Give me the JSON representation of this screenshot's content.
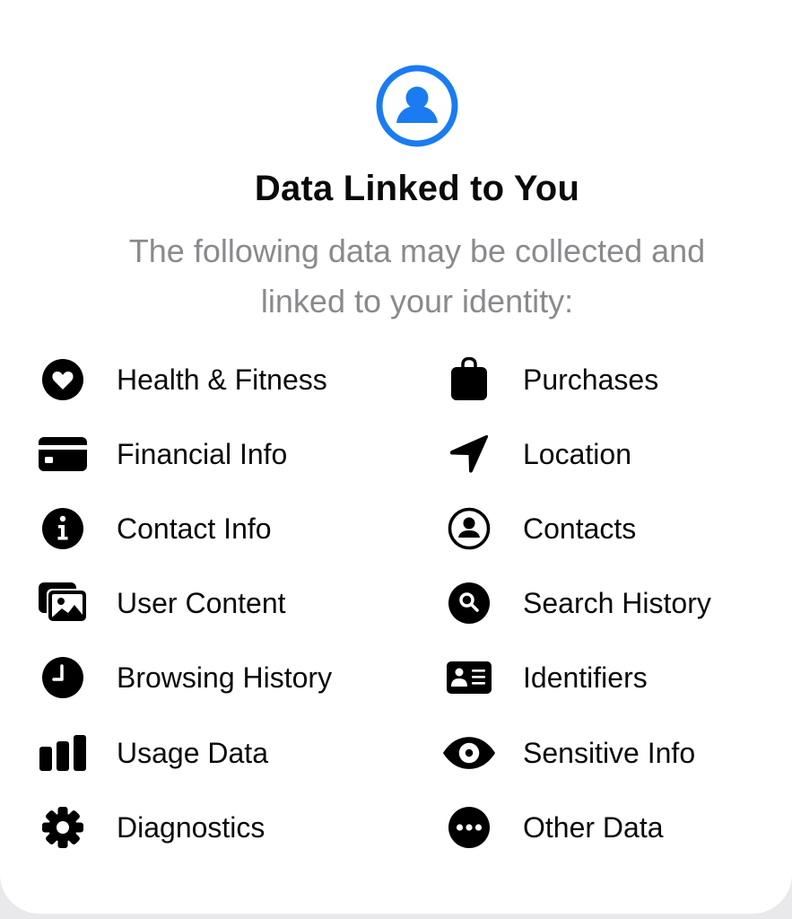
{
  "header": {
    "icon": "person-circle-icon",
    "icon_color": "#1a7cf0",
    "title": "Data Linked to You",
    "subtitle_line1": "The following data may be collected and",
    "subtitle_line2": "linked to your identity:"
  },
  "items_left": [
    {
      "label": "Health & Fitness",
      "icon": "heart-circle-icon"
    },
    {
      "label": "Financial Info",
      "icon": "credit-card-icon"
    },
    {
      "label": "Contact Info",
      "icon": "info-circle-icon"
    },
    {
      "label": "User Content",
      "icon": "photos-icon"
    },
    {
      "label": "Browsing History",
      "icon": "clock-icon"
    },
    {
      "label": "Usage Data",
      "icon": "bar-chart-icon"
    },
    {
      "label": "Diagnostics",
      "icon": "gear-icon"
    }
  ],
  "items_right": [
    {
      "label": "Purchases",
      "icon": "shopping-bag-icon"
    },
    {
      "label": "Location",
      "icon": "location-arrow-icon"
    },
    {
      "label": "Contacts",
      "icon": "person-circle-outline-icon"
    },
    {
      "label": "Search History",
      "icon": "magnifier-circle-icon"
    },
    {
      "label": "Identifiers",
      "icon": "id-card-icon"
    },
    {
      "label": "Sensitive Info",
      "icon": "eye-icon"
    },
    {
      "label": "Other Data",
      "icon": "ellipsis-circle-icon"
    }
  ]
}
